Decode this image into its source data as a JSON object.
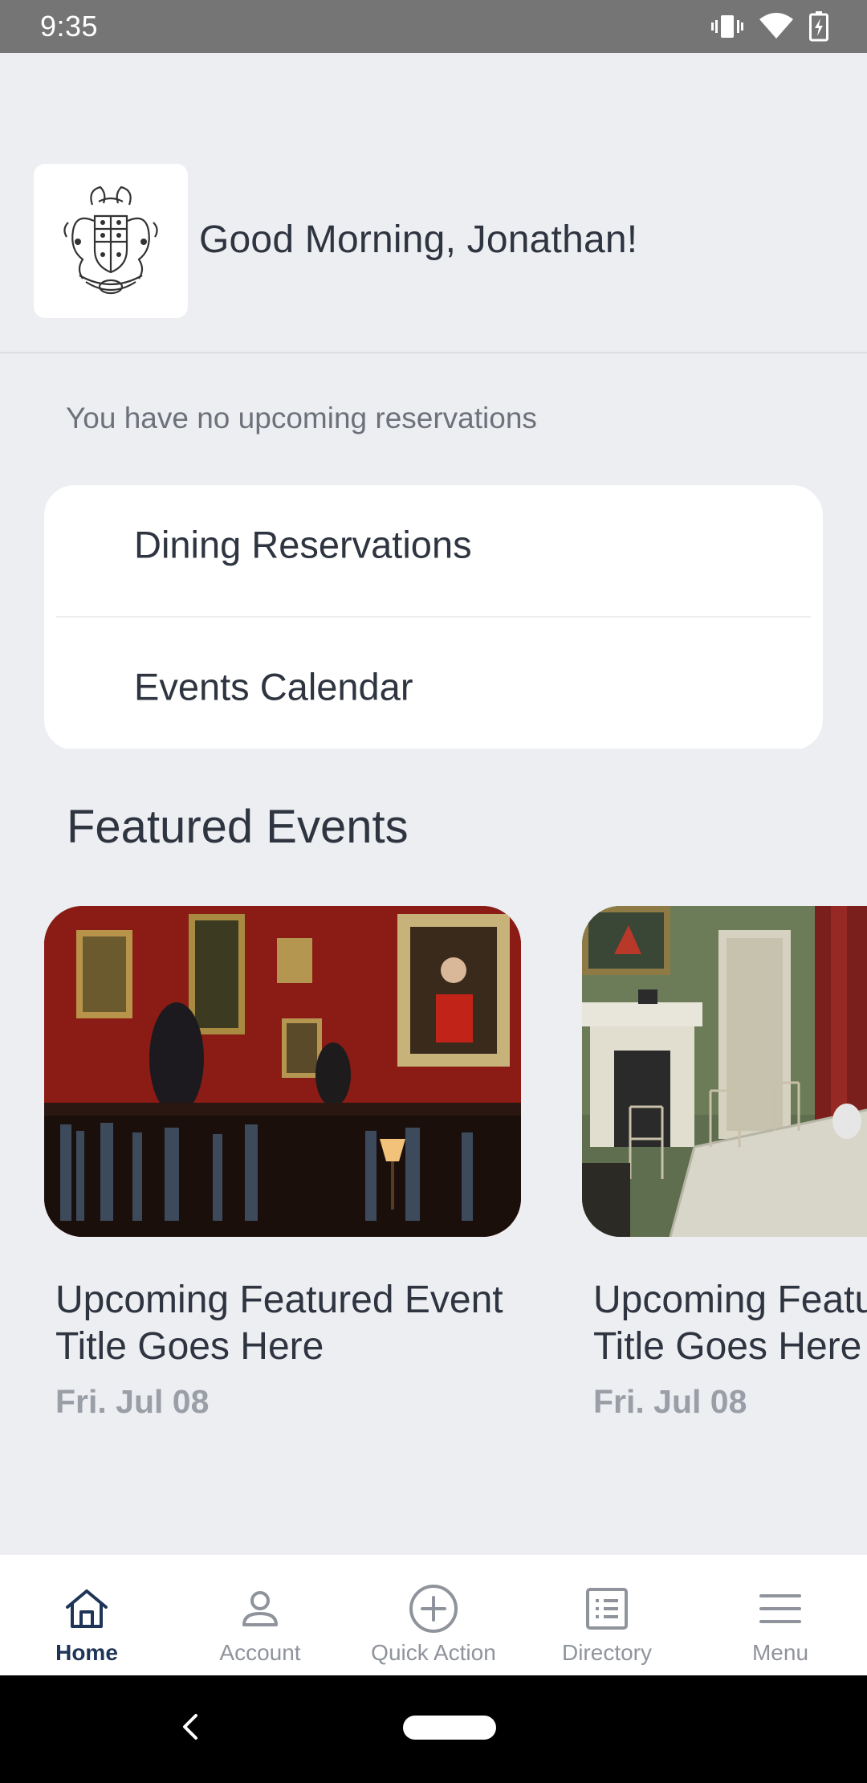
{
  "status_bar": {
    "time": "9:35",
    "icons": [
      "vibrate-icon",
      "wifi-icon",
      "battery-charging-icon"
    ]
  },
  "header": {
    "logo": "club-crest-logo",
    "greeting": "Good Morning, Jonathan!"
  },
  "reservations": {
    "message": "You have no upcoming reservations"
  },
  "quick_links": [
    {
      "label": "Dining Reservations"
    },
    {
      "label": "Events Calendar"
    }
  ],
  "featured": {
    "title": "Featured Events",
    "events": [
      {
        "title_line1": "Upcoming Featured Event",
        "title_line2": "Title Goes Here",
        "date": "Fri. Jul 08",
        "image": "library-room-photo"
      },
      {
        "title_line1": "Upcoming Featured Event",
        "title_line2": "Title Goes Here",
        "date": "Fri. Jul 08",
        "image": "dining-room-photo"
      }
    ]
  },
  "bottom_nav": {
    "items": [
      {
        "label": "Home",
        "icon": "home-icon",
        "active": true
      },
      {
        "label": "Account",
        "icon": "person-icon",
        "active": false
      },
      {
        "label": "Quick Action",
        "icon": "plus-circle-icon",
        "active": false
      },
      {
        "label": "Directory",
        "icon": "list-icon",
        "active": false
      },
      {
        "label": "Menu",
        "icon": "hamburger-icon",
        "active": false
      }
    ]
  },
  "colors": {
    "background": "#edeef2",
    "text_primary": "#2e3440",
    "nav_active": "#1f3558",
    "nav_inactive": "#8f939b"
  }
}
